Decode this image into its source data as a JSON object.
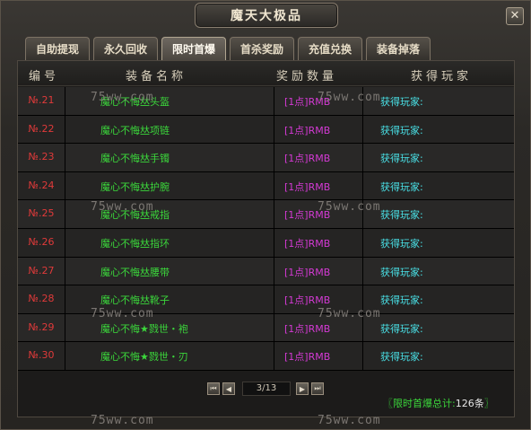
{
  "window": {
    "title": "魔天大极品",
    "close_label": "✕"
  },
  "tabs": [
    {
      "label": "自助提现"
    },
    {
      "label": "永久回收"
    },
    {
      "label": "限时首爆",
      "active": true
    },
    {
      "label": "首杀奖励"
    },
    {
      "label": "充值兑换"
    },
    {
      "label": "装备掉落"
    }
  ],
  "table": {
    "headers": {
      "no": "编号",
      "name": "装备名称",
      "reward": "奖励数量",
      "player": "获得玩家"
    },
    "rows": [
      {
        "no": "№.21",
        "name": "魔心不悔𠀤头盔",
        "reward": "[1点]RMB",
        "player": "获得玩家:"
      },
      {
        "no": "№.22",
        "name": "魔心不悔𠀤项链",
        "reward": "[1点]RMB",
        "player": "获得玩家:"
      },
      {
        "no": "№.23",
        "name": "魔心不悔𠀤手镯",
        "reward": "[1点]RMB",
        "player": "获得玩家:"
      },
      {
        "no": "№.24",
        "name": "魔心不悔𠀤护腕",
        "reward": "[1点]RMB",
        "player": "获得玩家:"
      },
      {
        "no": "№.25",
        "name": "魔心不悔𠀤戒指",
        "reward": "[1点]RMB",
        "player": "获得玩家:"
      },
      {
        "no": "№.26",
        "name": "魔心不悔𠀤指环",
        "reward": "[1点]RMB",
        "player": "获得玩家:"
      },
      {
        "no": "№.27",
        "name": "魔心不悔𠀤腰带",
        "reward": "[1点]RMB",
        "player": "获得玩家:"
      },
      {
        "no": "№.28",
        "name": "魔心不悔𠀤靴子",
        "reward": "[1点]RMB",
        "player": "获得玩家:"
      },
      {
        "no": "№.29",
        "name": "魔心不悔★戮世・袍",
        "reward": "[1点]RMB",
        "player": "获得玩家:"
      },
      {
        "no": "№.30",
        "name": "魔心不悔★戮世・刃",
        "reward": "[1点]RMB",
        "player": "获得玩家:"
      }
    ]
  },
  "pager": {
    "info": "3/13",
    "first": "⏮",
    "prev": "◀",
    "next": "▶",
    "last": "⏭"
  },
  "total": {
    "prefix": "〖限时首爆总计:",
    "value": "126条",
    "suffix": "〗"
  },
  "watermark": "75ww.com"
}
